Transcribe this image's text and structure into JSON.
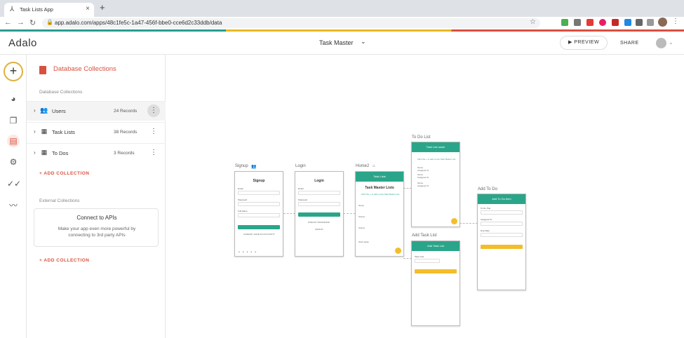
{
  "browser": {
    "tab_title": "Task Lists App",
    "url": "app.adalo.com/apps/48c1fe5c-1a47-456f-bbe0-cce6d2c33ddb/data"
  },
  "header": {
    "logo": "Adalo",
    "app_name": "Task Master",
    "preview_label": "▶ PREVIEW",
    "share_label": "SHARE"
  },
  "panel": {
    "title": "Database Collections",
    "section_label": "Database Collections",
    "collections": [
      {
        "name": "Users",
        "records": "24 Records",
        "icon": "users-icon"
      },
      {
        "name": "Task Lists",
        "records": "38 Records",
        "icon": "table-icon"
      },
      {
        "name": "To Dos",
        "records": "3 Records",
        "icon": "table-icon"
      }
    ],
    "add_collection": "+ ADD COLLECTION",
    "external_label": "External Collections",
    "api_title": "Connect to APIs",
    "api_desc": "Make your app even more powerful by connecting to 3rd party APIs",
    "add_collection_2": "+ ADD COLLECTION"
  },
  "canvas": {
    "screens": {
      "signup": {
        "label": "Signup",
        "heading": "Signup"
      },
      "login": {
        "label": "Login",
        "heading": "Login"
      },
      "home": {
        "label": "Home2",
        "bar": "Task Lists",
        "heading": "Task Master Lists",
        "hint": "Click the + to add a new Task Master List"
      },
      "todo": {
        "label": "To Do List",
        "bar": "Task List name",
        "hint": "Click the + to add a new Task Master List"
      },
      "addtask": {
        "label": "Add Task List",
        "bar": "Add Task List"
      },
      "addtodo": {
        "label": "Add To Do",
        "bar": "Add To Do Item"
      }
    }
  },
  "colors": {
    "accent_red": "#d9503f",
    "teal": "#2ba58a",
    "yellow": "#f4bd2a"
  }
}
